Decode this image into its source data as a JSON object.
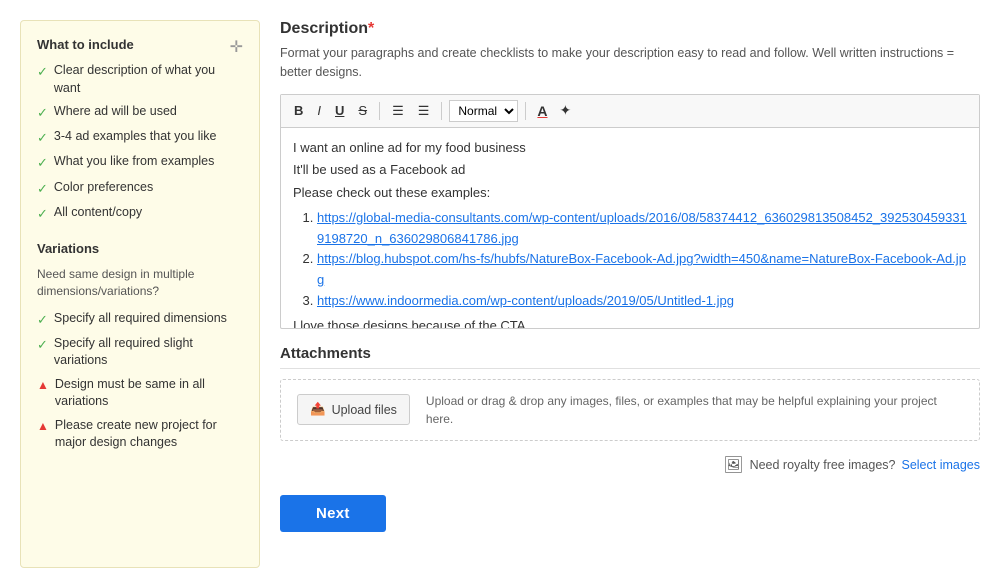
{
  "sidebar": {
    "title": "What to include",
    "move_icon": "⊕",
    "items": [
      {
        "type": "check",
        "text": "Clear description of what you want"
      },
      {
        "type": "check",
        "text": "Where ad will be used"
      },
      {
        "type": "check",
        "text": "3-4 ad examples that you like"
      },
      {
        "type": "check",
        "text": "What you like from examples"
      },
      {
        "type": "check",
        "text": "Color preferences"
      },
      {
        "type": "check",
        "text": "All content/copy"
      }
    ],
    "variations": {
      "title": "Variations",
      "subtitle": "Need same design in multiple dimensions/variations?",
      "items": [
        {
          "type": "check",
          "text": "Specify all required dimensions"
        },
        {
          "type": "check",
          "text": "Specify all required slight variations"
        },
        {
          "type": "warn",
          "text": "Design must be same in all variations"
        },
        {
          "type": "warn",
          "text": "Please create new project for major design changes"
        }
      ]
    }
  },
  "main": {
    "field_label": "Description",
    "required_marker": "*",
    "field_hint": "Format your paragraphs and create checklists to make your description easy to read and follow. Well written instructions = better designs.",
    "toolbar": {
      "bold": "B",
      "italic": "I",
      "underline": "U",
      "strikethrough": "S",
      "ordered_list": "≡",
      "unordered_list": "≡",
      "font_size": "Normal",
      "font_color_label": "A",
      "magic_icon": "✦"
    },
    "editor_content": {
      "line1": "I want an online ad for my food business",
      "line2": "It'll be used as a Facebook ad",
      "line3": "Please check out these examples:",
      "links": [
        {
          "num": 1,
          "url": "https://global-media-consultants.com/wp-content/uploads/2016/08/58374412_636029813508452_3925304593319198720_n_63602980684178​6.jpg",
          "display": "https://global-media-consultants.com/wp-content/uploads/2016/08/58374412_636029813508452_3925304593319198720_n_6360298​06841786.jpg"
        },
        {
          "num": 2,
          "url": "https://blog.hubspot.com/hs-fs/hubfs/NatureBox-Facebook-Ad.jpg?width=450&name=NatureBox-Facebook-Ad.jpg",
          "display": "https://blog.hubspot.com/hs-fs/hubfs/NatureBox-Facebook-Ad.jpg?width=450&name=NatureBox-Facebook-Ad.jpg"
        },
        {
          "num": 3,
          "url": "https://www.indoormedia.com/wp-content/uploads/2019/05/Untitled-1.jpg",
          "display": "https://www.indoormedia.com/wp-content/uploads/2019/05/Untitled-1.jpg"
        }
      ],
      "line4": "I love those designs because of the CTA"
    },
    "attachments": {
      "label": "Attachments",
      "upload_btn": "Upload files",
      "upload_hint": "Upload or drag & drop any images, files, or examples that may be helpful explaining your project here."
    },
    "royalty": {
      "text": "Need royalty free images?",
      "link_text": "Select images"
    },
    "next_btn": "Next"
  }
}
